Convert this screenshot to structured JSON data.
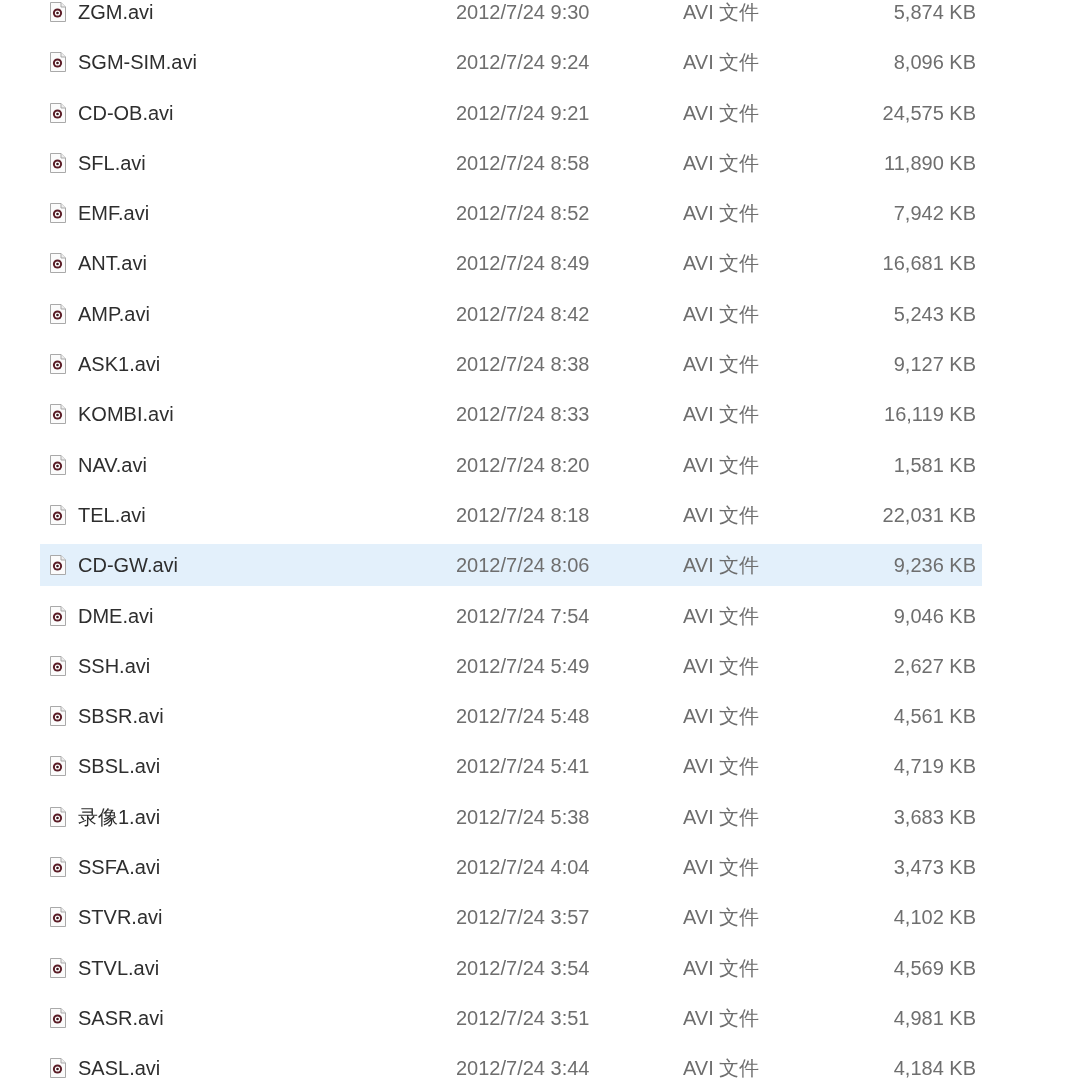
{
  "files": [
    {
      "name": "ZGM.avi",
      "date_modified": "2012/7/24 9:30",
      "type": "AVI 文件",
      "size": "5,874 KB",
      "selected": false
    },
    {
      "name": "SGM-SIM.avi",
      "date_modified": "2012/7/24 9:24",
      "type": "AVI 文件",
      "size": "8,096 KB",
      "selected": false
    },
    {
      "name": "CD-OB.avi",
      "date_modified": "2012/7/24 9:21",
      "type": "AVI 文件",
      "size": "24,575 KB",
      "selected": false
    },
    {
      "name": "SFL.avi",
      "date_modified": "2012/7/24 8:58",
      "type": "AVI 文件",
      "size": "11,890 KB",
      "selected": false
    },
    {
      "name": "EMF.avi",
      "date_modified": "2012/7/24 8:52",
      "type": "AVI 文件",
      "size": "7,942 KB",
      "selected": false
    },
    {
      "name": "ANT.avi",
      "date_modified": "2012/7/24 8:49",
      "type": "AVI 文件",
      "size": "16,681 KB",
      "selected": false
    },
    {
      "name": "AMP.avi",
      "date_modified": "2012/7/24 8:42",
      "type": "AVI 文件",
      "size": "5,243 KB",
      "selected": false
    },
    {
      "name": "ASK1.avi",
      "date_modified": "2012/7/24 8:38",
      "type": "AVI 文件",
      "size": "9,127 KB",
      "selected": false
    },
    {
      "name": "KOMBI.avi",
      "date_modified": "2012/7/24 8:33",
      "type": "AVI 文件",
      "size": "16,119 KB",
      "selected": false
    },
    {
      "name": "NAV.avi",
      "date_modified": "2012/7/24 8:20",
      "type": "AVI 文件",
      "size": "1,581 KB",
      "selected": false
    },
    {
      "name": "TEL.avi",
      "date_modified": "2012/7/24 8:18",
      "type": "AVI 文件",
      "size": "22,031 KB",
      "selected": false
    },
    {
      "name": "CD-GW.avi",
      "date_modified": "2012/7/24 8:06",
      "type": "AVI 文件",
      "size": "9,236 KB",
      "selected": true
    },
    {
      "name": "DME.avi",
      "date_modified": "2012/7/24 7:54",
      "type": "AVI 文件",
      "size": "9,046 KB",
      "selected": false
    },
    {
      "name": "SSH.avi",
      "date_modified": "2012/7/24 5:49",
      "type": "AVI 文件",
      "size": "2,627 KB",
      "selected": false
    },
    {
      "name": "SBSR.avi",
      "date_modified": "2012/7/24 5:48",
      "type": "AVI 文件",
      "size": "4,561 KB",
      "selected": false
    },
    {
      "name": "SBSL.avi",
      "date_modified": "2012/7/24 5:41",
      "type": "AVI 文件",
      "size": "4,719 KB",
      "selected": false
    },
    {
      "name": "录像1.avi",
      "date_modified": "2012/7/24 5:38",
      "type": "AVI 文件",
      "size": "3,683 KB",
      "selected": false
    },
    {
      "name": "SSFA.avi",
      "date_modified": "2012/7/24 4:04",
      "type": "AVI 文件",
      "size": "3,473 KB",
      "selected": false
    },
    {
      "name": "STVR.avi",
      "date_modified": "2012/7/24 3:57",
      "type": "AVI 文件",
      "size": "4,102 KB",
      "selected": false
    },
    {
      "name": "STVL.avi",
      "date_modified": "2012/7/24 3:54",
      "type": "AVI 文件",
      "size": "4,569 KB",
      "selected": false
    },
    {
      "name": "SASR.avi",
      "date_modified": "2012/7/24 3:51",
      "type": "AVI 文件",
      "size": "4,981 KB",
      "selected": false
    },
    {
      "name": "SASL.avi",
      "date_modified": "2012/7/24 3:44",
      "type": "AVI 文件",
      "size": "4,184 KB",
      "selected": false
    }
  ]
}
